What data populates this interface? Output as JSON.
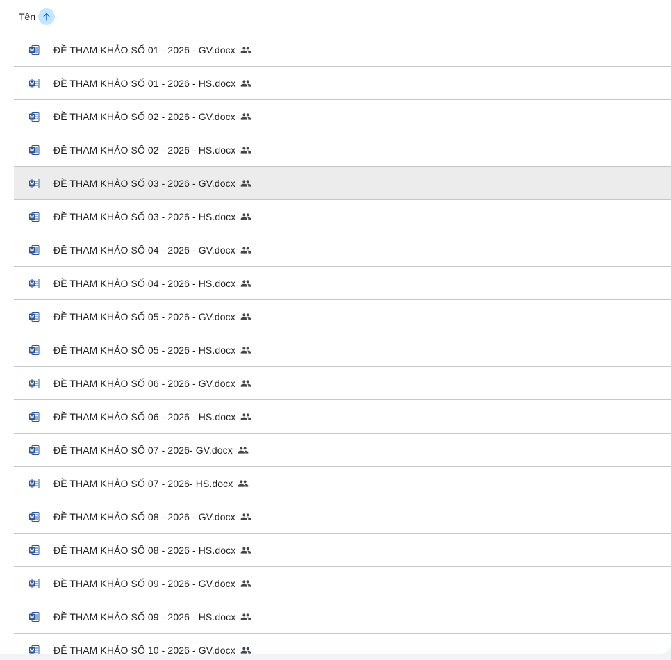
{
  "header": {
    "name_column_label": "Tên",
    "sort_direction": "ascending",
    "sort_icon": "arrow-up-icon"
  },
  "files": [
    {
      "name": "ĐỀ THAM KHẢO SỐ 01 - 2026 - GV.docx",
      "type_icon": "word-doc-icon",
      "shared": true,
      "selected": false
    },
    {
      "name": "ĐỀ THAM KHẢO SỐ 01 - 2026 - HS.docx",
      "type_icon": "word-doc-icon",
      "shared": true,
      "selected": false
    },
    {
      "name": "ĐỀ THAM KHẢO SỐ 02 - 2026 - GV.docx",
      "type_icon": "word-doc-icon",
      "shared": true,
      "selected": false
    },
    {
      "name": "ĐỀ THAM KHẢO SỐ 02 - 2026 - HS.docx",
      "type_icon": "word-doc-icon",
      "shared": true,
      "selected": false
    },
    {
      "name": "ĐỀ THAM KHẢO SỐ 03 - 2026 - GV.docx",
      "type_icon": "word-doc-icon",
      "shared": true,
      "selected": true
    },
    {
      "name": "ĐỀ THAM KHẢO SỐ 03 - 2026 - HS.docx",
      "type_icon": "word-doc-icon",
      "shared": true,
      "selected": false
    },
    {
      "name": "ĐỀ THAM KHẢO SỐ 04 - 2026 - GV.docx",
      "type_icon": "word-doc-icon",
      "shared": true,
      "selected": false
    },
    {
      "name": "ĐỀ THAM KHẢO SỐ 04 - 2026 - HS.docx",
      "type_icon": "word-doc-icon",
      "shared": true,
      "selected": false
    },
    {
      "name": "ĐỀ THAM KHẢO SỐ 05 - 2026 - GV.docx",
      "type_icon": "word-doc-icon",
      "shared": true,
      "selected": false
    },
    {
      "name": "ĐỀ THAM KHẢO SỐ 05 - 2026 - HS.docx",
      "type_icon": "word-doc-icon",
      "shared": true,
      "selected": false
    },
    {
      "name": "ĐỀ THAM KHẢO SỐ 06 - 2026 - GV.docx",
      "type_icon": "word-doc-icon",
      "shared": true,
      "selected": false
    },
    {
      "name": "ĐỀ THAM KHẢO SỐ 06 - 2026 - HS.docx",
      "type_icon": "word-doc-icon",
      "shared": true,
      "selected": false
    },
    {
      "name": "ĐỀ THAM KHẢO SỐ 07 - 2026- GV.docx",
      "type_icon": "word-doc-icon",
      "shared": true,
      "selected": false
    },
    {
      "name": "ĐỀ THAM KHẢO SỐ 07 - 2026- HS.docx",
      "type_icon": "word-doc-icon",
      "shared": true,
      "selected": false
    },
    {
      "name": "ĐỀ THAM KHẢO SỐ 08 - 2026 - GV.docx",
      "type_icon": "word-doc-icon",
      "shared": true,
      "selected": false
    },
    {
      "name": "ĐỀ THAM KHẢO SỐ 08 - 2026 - HS.docx",
      "type_icon": "word-doc-icon",
      "shared": true,
      "selected": false
    },
    {
      "name": "ĐỀ THAM KHẢO SỐ 09 - 2026 - GV.docx",
      "type_icon": "word-doc-icon",
      "shared": true,
      "selected": false
    },
    {
      "name": "ĐỀ THAM KHẢO SỐ 09 - 2026 - HS.docx",
      "type_icon": "word-doc-icon",
      "shared": true,
      "selected": false
    },
    {
      "name": "ĐỀ THAM KHẢO SỐ 10 - 2026 - GV.docx",
      "type_icon": "word-doc-icon",
      "shared": true,
      "selected": false
    }
  ],
  "colors": {
    "word_blue": "#2b579a",
    "word_light": "#41a5ee",
    "sort_chip_bg": "#c2e7ff",
    "selected_row_bg": "#ececec",
    "divider": "#c7c7c7",
    "page_bg": "#f0f4f9"
  }
}
